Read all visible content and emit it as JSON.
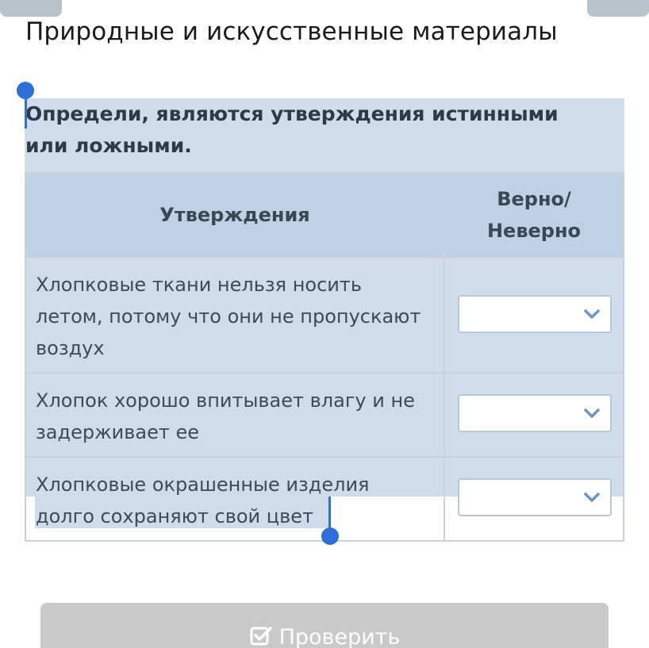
{
  "page": {
    "title": "Природные и искусственные материалы"
  },
  "task": {
    "question": "Определи, являются утверждения истинными или ложными."
  },
  "table": {
    "headers": {
      "statement": "Утверждения",
      "answer_line1": "Верно/",
      "answer_line2": "Неверно"
    },
    "rows": [
      {
        "statement": "Хлопковые ткани нельзя носить летом, потому что они не пропускают воздух",
        "selected": ""
      },
      {
        "statement": "Хлопок хорошо впитывает влагу и не задерживает ее",
        "selected": ""
      },
      {
        "statement": "Хлопковые окрашенные изделия долго сохраняют свой цвет",
        "selected": ""
      }
    ]
  },
  "actions": {
    "check_label": "Проверить"
  },
  "colors": {
    "selection": "#cfdcec",
    "header_bg": "#bfd1e4",
    "selection_handle": "#2f6fd8",
    "button_disabled": "#c9c9c9"
  },
  "icons": {
    "dropdown": "chevron-down-icon",
    "check": "checkbox-check-icon"
  }
}
